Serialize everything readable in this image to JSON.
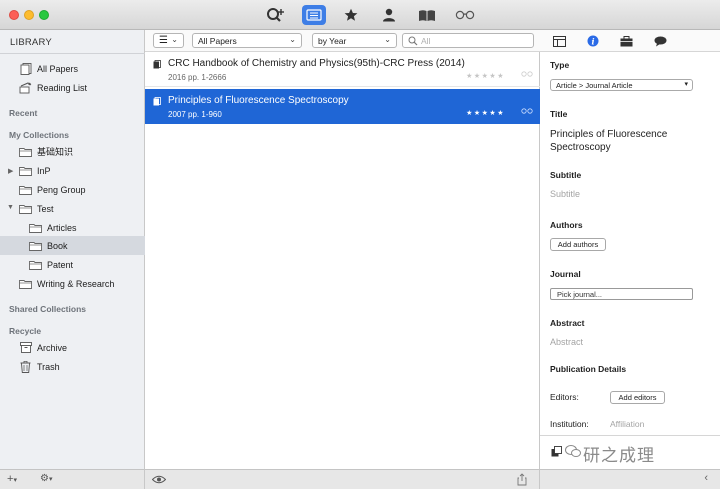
{
  "sidebar": {
    "header": "LIBRARY",
    "items": [
      {
        "label": "All Papers"
      },
      {
        "label": "Reading List"
      }
    ],
    "sections": {
      "recent": "Recent",
      "my_collections": "My Collections",
      "shared": "Shared Collections",
      "recycle": "Recycle"
    },
    "collections": [
      {
        "label": "基础知识"
      },
      {
        "label": "InP"
      },
      {
        "label": "Peng Group"
      },
      {
        "label": "Test"
      },
      {
        "label": "Articles"
      },
      {
        "label": "Book"
      },
      {
        "label": "Patent"
      },
      {
        "label": "Writing & Research"
      }
    ],
    "recycle_items": [
      {
        "label": "Archive"
      },
      {
        "label": "Trash"
      }
    ],
    "selected_collection": "Book"
  },
  "list_toolbar": {
    "filter": "All Papers",
    "sort": "by Year",
    "search_placeholder": "All"
  },
  "papers": [
    {
      "title": "CRC Handbook of Chemistry and Physics(95th)-CRC Press (2014)",
      "meta": "2016 pp. 1-2666",
      "stars": "★★★★★"
    },
    {
      "title": "Principles of Fluorescence Spectroscopy",
      "meta": "2007 pp. 1-960",
      "stars": "★★★★★"
    }
  ],
  "inspector": {
    "type_label": "Type",
    "type_value": "Article > Journal Article",
    "title_label": "Title",
    "title_value": "Principles of Fluorescence Spectroscopy",
    "subtitle_label": "Subtitle",
    "subtitle_placeholder": "Subtitle",
    "authors_label": "Authors",
    "add_authors": "Add authors",
    "journal_label": "Journal",
    "pick_journal": "Pick journal...",
    "abstract_label": "Abstract",
    "abstract_placeholder": "Abstract",
    "publication_label": "Publication Details",
    "editors_label": "Editors:",
    "add_editors": "Add editors",
    "institution_label": "Institution:",
    "institution_placeholder": "Affiliation"
  },
  "watermark": "研之成理",
  "colors": {
    "selection": "#1f66d6",
    "toolbar_selected": "#3e7ee6",
    "info_icon": "#2a6ae6"
  }
}
